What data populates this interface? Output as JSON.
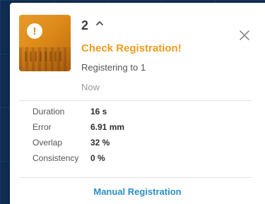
{
  "notification": {
    "count": "2",
    "title": "Check Registration!",
    "subtitle": "Registering to 1",
    "time": "Now",
    "icons": {
      "expand": "chevron-up-icon",
      "close": "close-icon",
      "thumbnail": "warning-icon"
    },
    "stats": [
      {
        "label": "Duration",
        "value": "16 s"
      },
      {
        "label": "Error",
        "value": "6.91 mm"
      },
      {
        "label": "Overlap",
        "value": "32 %"
      },
      {
        "label": "Consistency",
        "value": "0 %"
      }
    ],
    "action_label": "Manual Registration",
    "colors": {
      "accent": "#f39a1e",
      "link": "#2b8fc6",
      "background": "#0f2c52"
    }
  }
}
